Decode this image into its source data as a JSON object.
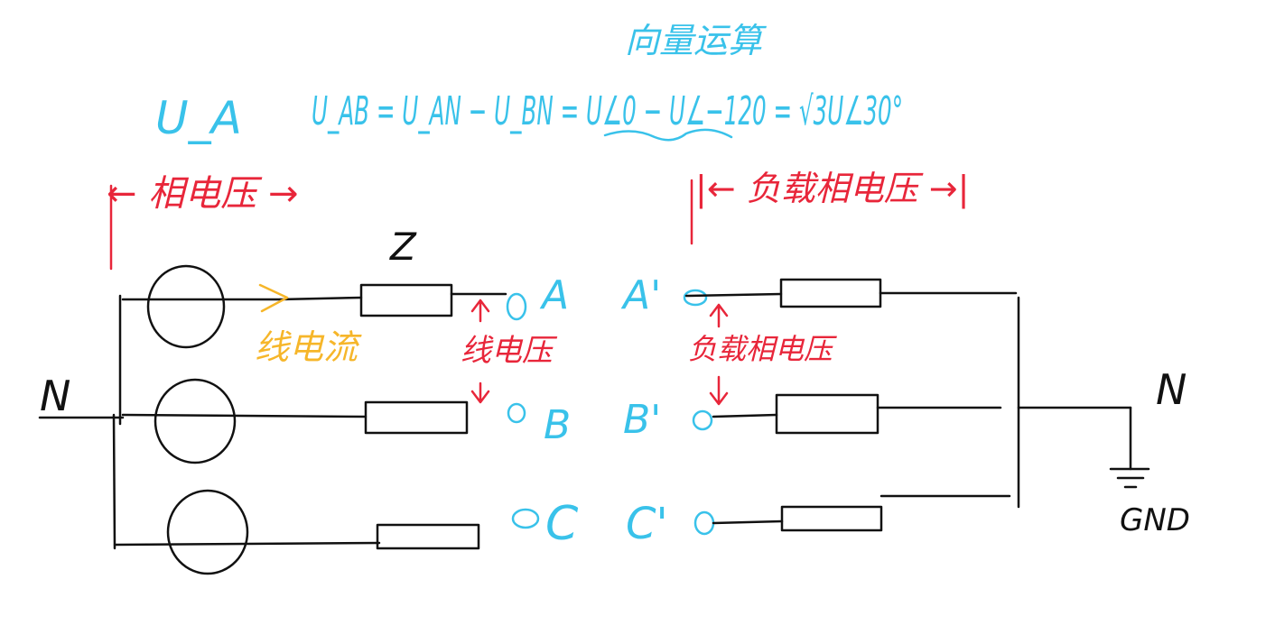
{
  "colors": {
    "ink": "#111111",
    "red": "#e8263a",
    "cyan": "#39c2ea",
    "orange": "#f6b62a",
    "background": "#ffffff"
  },
  "annotations": {
    "vector_method": "向量运算",
    "formula": "U_AB = U_AN − U_BN = U∠0 − U∠−120 = √3U∠30°",
    "phase_symbol": "U_A",
    "phase_voltage_left": "← 相电压 →",
    "load_phase_voltage_top": "|← 负载相电压 →|",
    "impedance": "Z",
    "line_current": "线电流",
    "line_voltage": "线电压",
    "load_phase_voltage_mid": "负载相电压",
    "neutral_left": "N",
    "neutral_right": "N",
    "ground": "GND"
  },
  "nodes": {
    "source_terminals": [
      "A",
      "B",
      "C"
    ],
    "load_terminals": [
      "A'",
      "B'",
      "C'"
    ]
  },
  "icons": [
    "voltage-source-icon",
    "impedance-icon",
    "ground-icon",
    "arrow-icon"
  ]
}
